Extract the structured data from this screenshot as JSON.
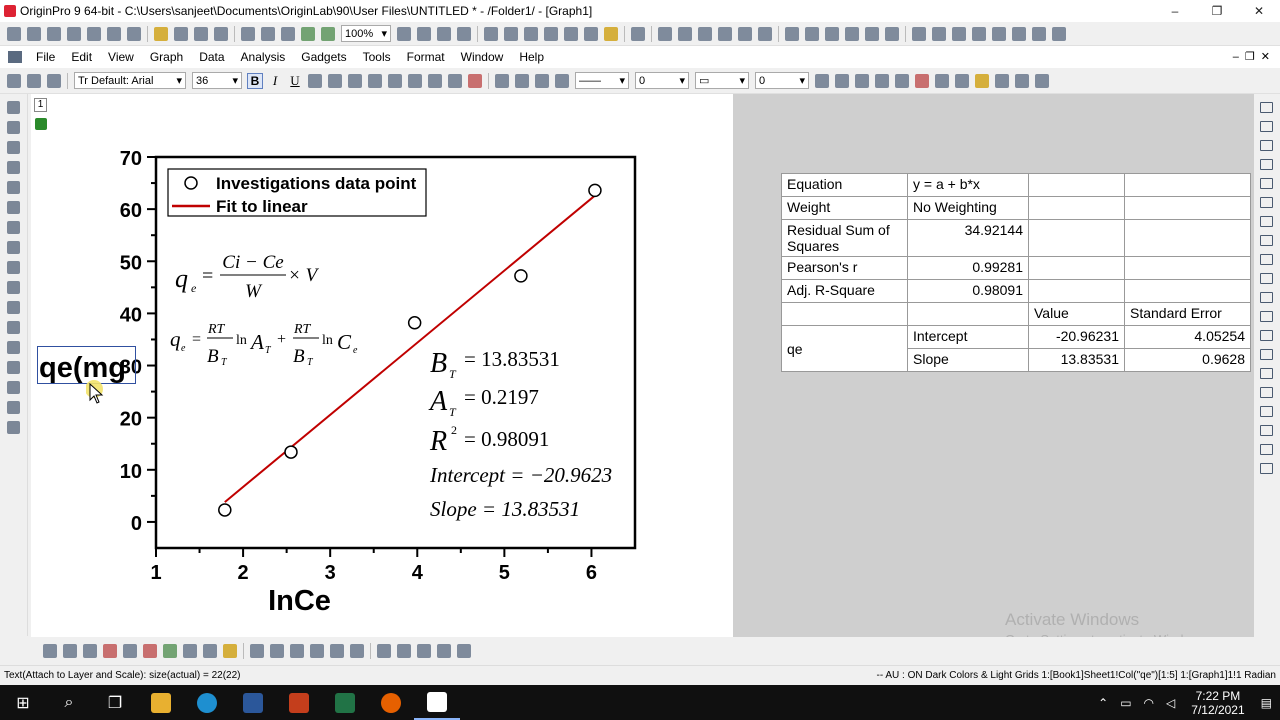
{
  "window": {
    "title": "OriginPro 9 64-bit - C:\\Users\\sanjeet\\Documents\\OriginLab\\90\\User Files\\UNTITLED * - /Folder1/ - [Graph1]",
    "minimize": "–",
    "maximize": "❐",
    "close": "✕"
  },
  "toolbar": {
    "zoom": "100%",
    "font": "Tr Default: Arial",
    "font_size": "36",
    "bold": "B",
    "italic": "I",
    "underline": "U",
    "line_width": "0",
    "border_width": "0"
  },
  "menu": [
    "File",
    "Edit",
    "View",
    "Graph",
    "Data",
    "Analysis",
    "Gadgets",
    "Tools",
    "Format",
    "Window",
    "Help"
  ],
  "layer_label": "1",
  "chart_data": {
    "type": "scatter",
    "xlabel": "InCe",
    "ylabel": "qe(mg",
    "xlim": [
      1,
      6.5
    ],
    "ylim": [
      -5,
      70
    ],
    "xticks": [
      "1",
      "2",
      "3",
      "4",
      "5",
      "6"
    ],
    "yticks": [
      "0",
      "10",
      "20",
      "30",
      "40",
      "50",
      "60",
      "70"
    ],
    "points": [
      {
        "x": 1.79,
        "y": 2.3
      },
      {
        "x": 2.55,
        "y": 13.4
      },
      {
        "x": 3.97,
        "y": 38.2
      },
      {
        "x": 5.19,
        "y": 47.2
      },
      {
        "x": 6.04,
        "y": 63.6
      }
    ],
    "fit": {
      "intercept": -20.96231,
      "slope": 13.83531,
      "x_range": [
        1.79,
        6.04
      ]
    },
    "legend": [
      "Investigations data point",
      "Fit to linear"
    ],
    "series_colors": {
      "points": "#000000",
      "fit": "#c00000"
    },
    "equations": {
      "qe_symbol": "q",
      "qe_sub": "e",
      "frac1_num": "Ci − Ce",
      "frac1_den": "W",
      "times_v": "× V",
      "eq2_rt": "RT",
      "eq2_bt": "B",
      "eq2_t": "T",
      "eq2_ln": "ln",
      "eq2_a": "A",
      "eq2_c": "C",
      "eq2_plus": "+",
      "eq_sign": "="
    },
    "results": {
      "bt_sym": "B",
      "bt_val": "= 13.83531",
      "at_sym": "A",
      "at_val": "= 0.2197",
      "r_sym": "R",
      "r_sup": "2",
      "r_val": "= 0.98091",
      "intercept": "Intercept = −20.9623",
      "slope": "Slope = 13.83531"
    }
  },
  "stats_table": {
    "rows": [
      [
        "Equation",
        "y = a + b*x",
        "",
        ""
      ],
      [
        "Weight",
        "No Weighting",
        "",
        ""
      ],
      [
        "Residual Sum of Squares",
        "34.92144",
        "",
        ""
      ],
      [
        "Pearson's r",
        "0.99281",
        "",
        ""
      ],
      [
        "Adj. R-Square",
        "0.98091",
        "",
        ""
      ]
    ],
    "header": [
      "",
      "",
      "Value",
      "Standard Error"
    ],
    "group": "qe",
    "params": [
      [
        "Intercept",
        "-20.96231",
        "4.05254"
      ],
      [
        "Slope",
        "13.83531",
        "0.9628"
      ]
    ]
  },
  "watermark": {
    "title": "Activate Windows",
    "sub": "Go to Settings to activate Windows."
  },
  "status": {
    "left": "Text(Attach to Layer and Scale): size(actual) = 22(22)",
    "right": "-- AU : ON  Dark Colors & Light Grids  1:[Book1]Sheet1!Col(\"qe\")[1:5]  1:[Graph1]1!1  Radian"
  },
  "taskbar": {
    "time": "7:22 PM",
    "date": "7/12/2021"
  }
}
